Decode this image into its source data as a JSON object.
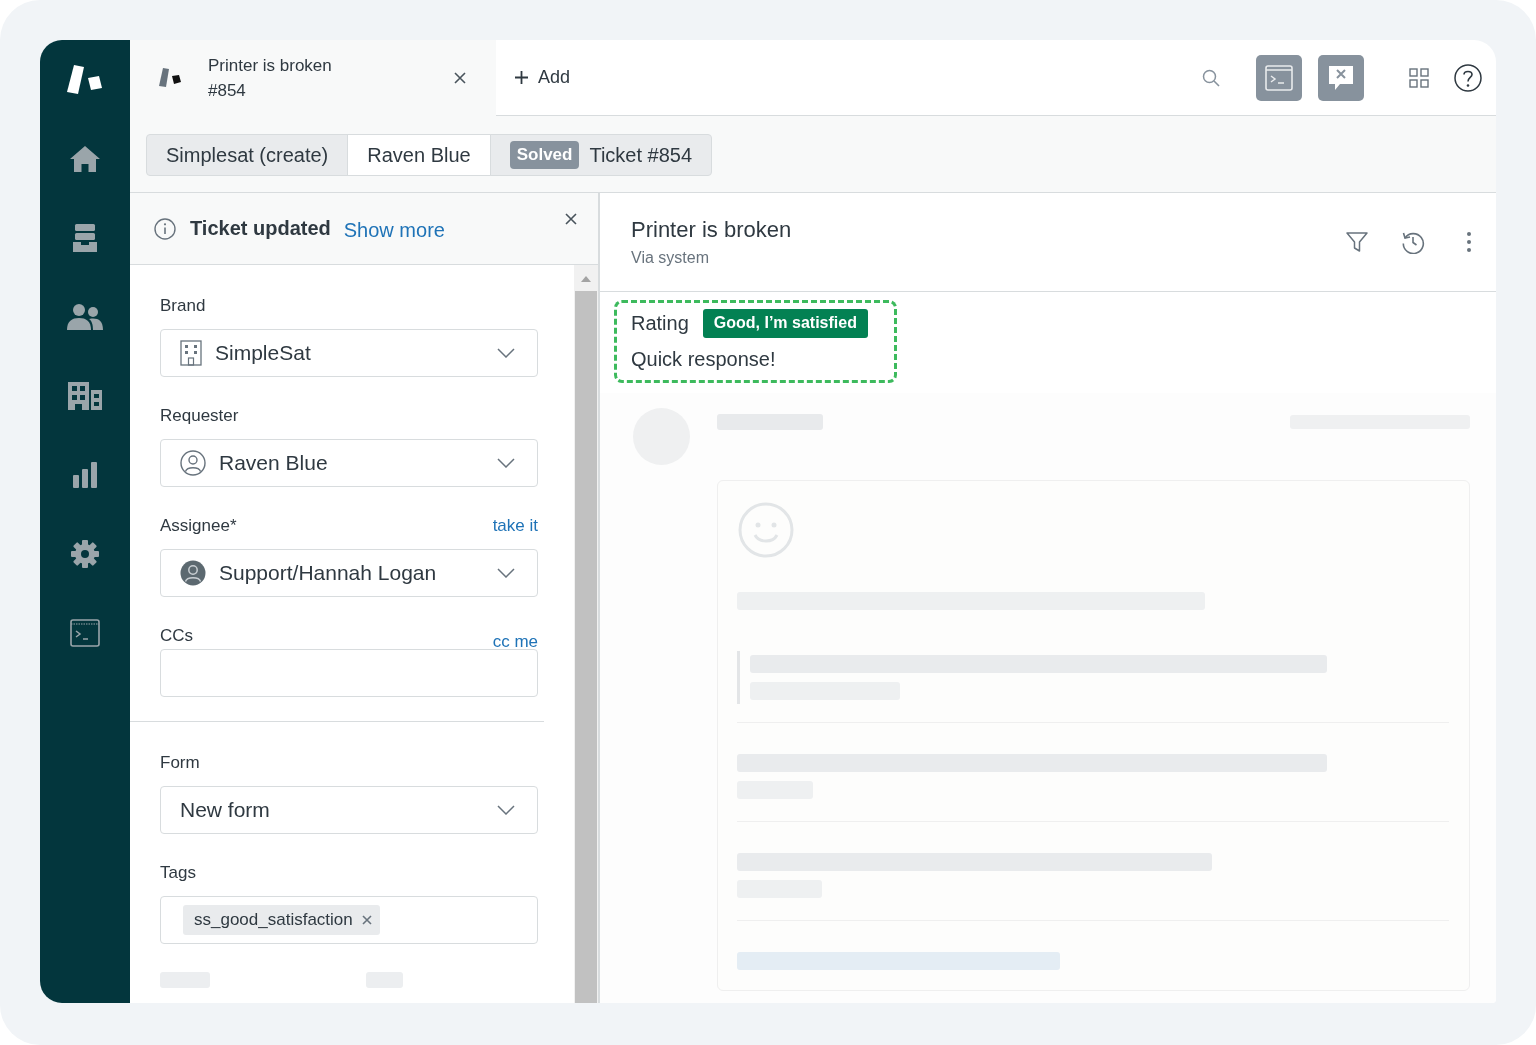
{
  "tabs": [
    {
      "title": "Printer is broken",
      "number": "#854",
      "selected": true
    }
  ],
  "toolbar": {
    "add_label": "Add"
  },
  "breadcrumbs": [
    {
      "label": "Simplesat (create)",
      "selected": false
    },
    {
      "label": "Raven Blue",
      "selected": true
    },
    {
      "badge": "Solved",
      "label": "Ticket #854",
      "selected": false
    }
  ],
  "notification": {
    "title": "Ticket updated",
    "link": "Show more"
  },
  "sections": [
    {
      "fields": [
        {
          "kind": "organization",
          "label": "Brand",
          "value": "SimpleSat"
        },
        {
          "kind": "person",
          "label": "Requester",
          "value": "Raven Blue"
        },
        {
          "kind": "agent",
          "label": "Assignee*",
          "action": "take it",
          "value": "Support/Hannah Logan"
        },
        {
          "kind": "emails",
          "label": "CCs",
          "action": "cc me"
        }
      ]
    },
    {
      "fields": [
        {
          "kind": "plain",
          "label": "Form",
          "value": "New form"
        },
        {
          "kind": "tags",
          "label": "Tags",
          "tags": [
            "ss_good_satisfaction"
          ]
        }
      ]
    }
  ],
  "conversation": {
    "title": "Printer is broken",
    "channel": "Via system",
    "rating": {
      "outlined": true,
      "label": "Rating",
      "badge": "Good, I’m satisfied",
      "comment": "Quick response!"
    }
  }
}
